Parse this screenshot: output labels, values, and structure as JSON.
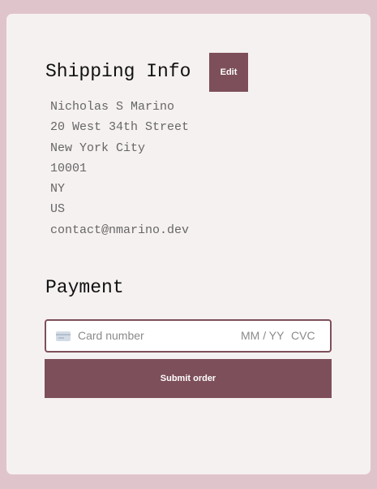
{
  "shipping": {
    "title": "Shipping Info",
    "edit_label": "Edit",
    "address_lines": [
      "Nicholas S Marino",
      "20 West 34th Street",
      "New York City",
      "10001",
      "NY",
      "US",
      "contact@nmarino.dev"
    ]
  },
  "payment": {
    "title": "Payment",
    "card_number_placeholder": "Card number",
    "expiry_placeholder": "MM / YY",
    "cvc_placeholder": "CVC",
    "submit_label": "Submit order"
  },
  "icons": {
    "card": "credit-card-icon"
  },
  "colors": {
    "background": "#dfc5cb",
    "card": "#f6f1f1",
    "accent": "#7d4f5a"
  }
}
